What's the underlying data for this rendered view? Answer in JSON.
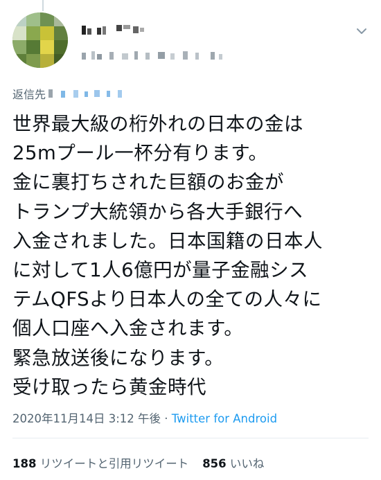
{
  "reply": {
    "prefix": "返信先"
  },
  "tweet": {
    "lines": [
      "世界最大級の桁外れの日本の金は",
      "25mプール一杯分有ります。",
      "金に裏打ちされた巨額のお金が",
      "トランプ大統領から各大手銀行へ",
      "入金されました。日本国籍の日本人",
      "に対して1人6億円が量子金融シス",
      "テムQFSより日本人の全ての人々に",
      "個人口座へ入金されます。",
      "緊急放送後になります。",
      "受け取ったら黄金時代"
    ],
    "timestamp": "2020年11月14日 3:12 午後",
    "separator": "·",
    "source": "Twitter for Android"
  },
  "stats": {
    "retweets_count": "188",
    "retweets_label": "リツイートと引用リツイート",
    "likes_count": "856",
    "likes_label": "いいね"
  },
  "icons": {
    "menu": "chevron-down-icon"
  },
  "colors": {
    "text": "#0f1419",
    "secondary": "#536471",
    "link": "#1d9bf0",
    "divider": "#e6ecf0"
  }
}
